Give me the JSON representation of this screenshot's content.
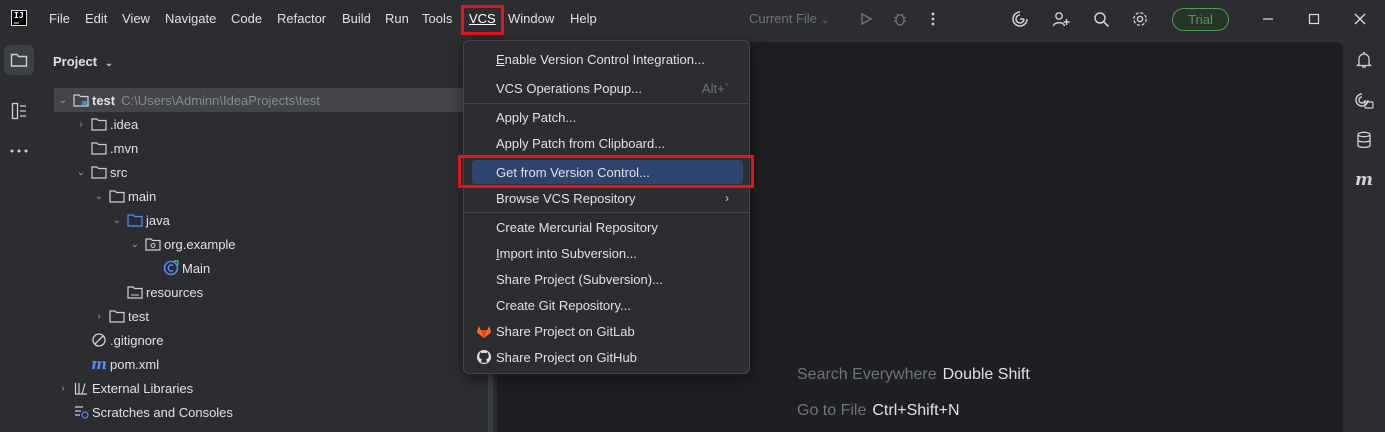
{
  "logo": {
    "text": "IJ"
  },
  "menu": {
    "items": [
      "File",
      "Edit",
      "View",
      "Navigate",
      "Code",
      "Refactor",
      "Build",
      "Run",
      "Tools",
      "VCS",
      "Window",
      "Help"
    ]
  },
  "run_config": {
    "label": "Current File"
  },
  "trial": {
    "label": "Trial"
  },
  "project_panel": {
    "title": "Project",
    "tree": [
      {
        "label": "test",
        "path": "C:\\Users\\Adminn\\IdeaProjects\\test"
      },
      {
        "label": ".idea"
      },
      {
        "label": ".mvn"
      },
      {
        "label": "src"
      },
      {
        "label": "main"
      },
      {
        "label": "java"
      },
      {
        "label": "org.example"
      },
      {
        "label": "Main"
      },
      {
        "label": "resources"
      },
      {
        "label": "test"
      },
      {
        "label": ".gitignore"
      },
      {
        "label": "pom.xml"
      },
      {
        "label": "External Libraries"
      },
      {
        "label": "Scratches and Consoles"
      }
    ]
  },
  "editor": {
    "hints": [
      {
        "key": "Search Everywhere",
        "value": "Double Shift"
      },
      {
        "key": "Go to File",
        "value": "Ctrl+Shift+N"
      }
    ]
  },
  "vcs_menu": {
    "items": [
      {
        "prefix": "",
        "mnemonic": "E",
        "rest": "nable Version Control Integration..."
      },
      {
        "label": "VCS Operations Popup...",
        "shortcut": "Alt+`"
      },
      {
        "label": "Apply Patch..."
      },
      {
        "label": "Apply Patch from Clipboard..."
      },
      {
        "label": "Get from Version Control..."
      },
      {
        "label": "Browse VCS Repository"
      },
      {
        "label": "Create Mercurial Repository"
      },
      {
        "prefix": "",
        "mnemonic": "I",
        "rest": "mport into Subversion..."
      },
      {
        "label": "Share Project (Subversion)..."
      },
      {
        "label": "Create Git Repository..."
      },
      {
        "label": "Share Project on GitLab"
      },
      {
        "label": "Share Project on GitHub"
      }
    ]
  },
  "colors": {
    "highlight_box": "#e2131f",
    "selection": "#2e436e",
    "trial_green": "#57965c"
  }
}
